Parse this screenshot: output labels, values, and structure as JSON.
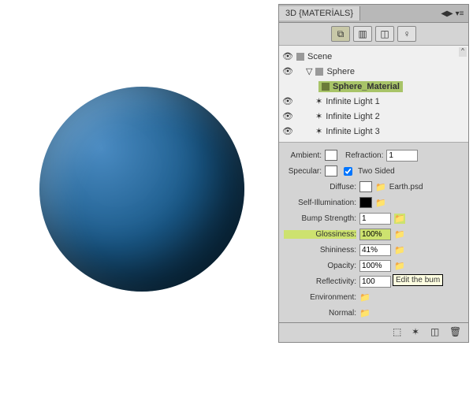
{
  "panel": {
    "title": "3D {MATERİALS}"
  },
  "tree": {
    "scene": "Scene",
    "sphere": "Sphere",
    "material": "Sphere_Material",
    "light1": "Infinite Light 1",
    "light2": "Infinite Light 2",
    "light3": "Infinite Light 3"
  },
  "props": {
    "ambient": {
      "label": "Ambient:"
    },
    "refraction": {
      "label": "Refraction:",
      "value": "1"
    },
    "specular": {
      "label": "Specular:"
    },
    "twosided": {
      "label": "Two Sided",
      "checked": true
    },
    "diffuse": {
      "label": "Diffuse:",
      "file": "Earth.psd"
    },
    "selfillum": {
      "label": "Self-Illumination:"
    },
    "bump": {
      "label": "Bump Strength:",
      "value": "1"
    },
    "gloss": {
      "label": "Glossiness:",
      "value": "100%"
    },
    "shine": {
      "label": "Shininess:",
      "value": "41%"
    },
    "opacity": {
      "label": "Opacity:",
      "value": "100%"
    },
    "reflect": {
      "label": "Reflectivity:",
      "value": "100"
    },
    "env": {
      "label": "Environment:"
    },
    "normal": {
      "label": "Normal:"
    }
  },
  "tooltip": "Edit the bum"
}
